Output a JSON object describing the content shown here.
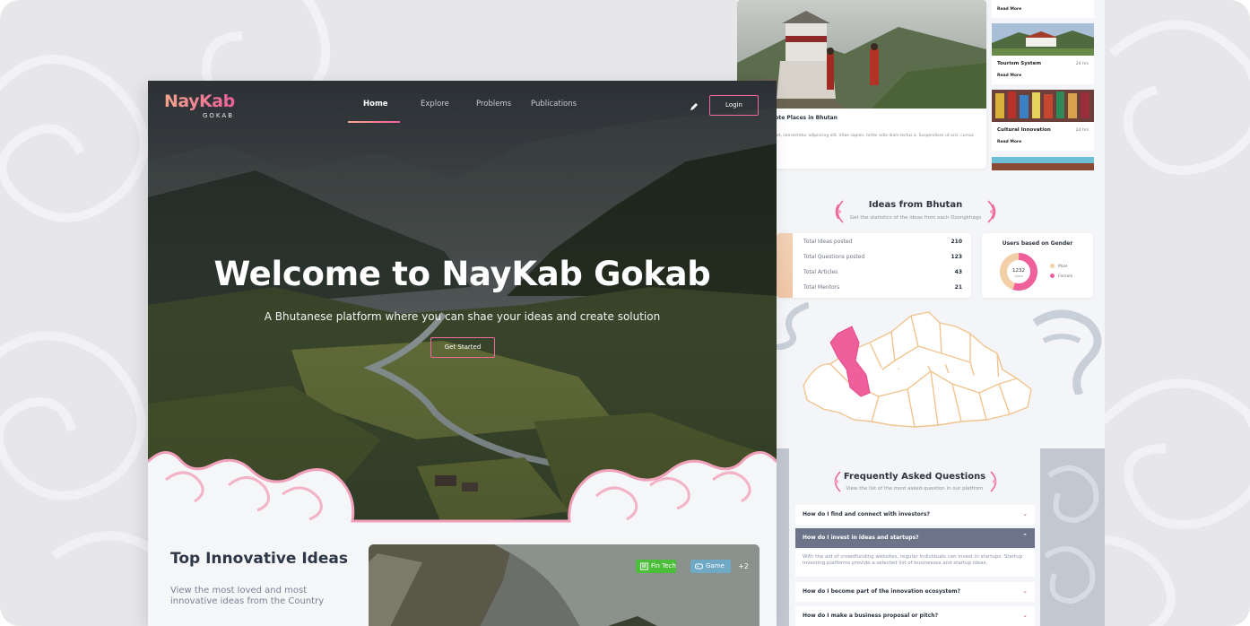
{
  "brand": {
    "name": "NayKab",
    "sub": "GOKAB"
  },
  "nav": {
    "items": [
      "Home",
      "Explore",
      "Problems",
      "Publications"
    ],
    "login": "Login"
  },
  "hero": {
    "title": "Welcome to NayKab Gokab",
    "subtitle": "A Bhutanese platform where you can shae your ideas and create solution",
    "cta": "Get Started"
  },
  "top_ideas": {
    "title": "Top Innovative Ideas",
    "subtitle": "View the most loved and most innovative ideas from the Country",
    "tags": [
      "Fin Tech",
      "Game"
    ],
    "more": "+2"
  },
  "feature": {
    "title": "mote Places in Bhutan",
    "text": "sit amet, consectetur adipiscing elit. Vitae sapien, tortor odio diam lectus a. Suspendisse ut orci, cursus cursus"
  },
  "side_list": [
    {
      "title": "",
      "date": "",
      "more": "Read More"
    },
    {
      "title": "Tourism System",
      "date": "24 hrs",
      "more": "Read More"
    },
    {
      "title": "Cultural Innovation",
      "date": "24 hrs",
      "more": "Read More"
    }
  ],
  "ideas": {
    "title": "Ideas from Bhutan",
    "subtitle": "Get the statistics of the ideas from each Dzongkhags",
    "stats": [
      {
        "label": "Total Ideas posted",
        "value": "210"
      },
      {
        "label": "Total Questions posted",
        "value": "123"
      },
      {
        "label": "Total Articles",
        "value": "43"
      },
      {
        "label": "Total Mentors",
        "value": "21"
      }
    ],
    "gender": {
      "title": "Users based on Gender",
      "total": "1232",
      "total_label": "Users",
      "male_label": "Male",
      "female_label": "Female",
      "male_fraction": 0.45,
      "female_fraction": 0.55,
      "male_color": "#f2cfa6",
      "female_color": "#ee5f9c"
    }
  },
  "faq": {
    "title": "Frequently Asked Questions",
    "subtitle": "View the list of the most asked question in our platfrom",
    "items": [
      {
        "q": "How do I find and connect with investors?"
      },
      {
        "q": "How do I invest in ideas and startups?"
      },
      {
        "q": "How do I become part of the innovation ecosystem?"
      },
      {
        "q": "How do I make a business proposal or pitch?"
      }
    ],
    "answer": "With the aid of crowdfunding websites, regular individuals can invest in startups. Startup investing platforms provide a selected list of businesses and startup ideas."
  },
  "colors": {
    "accent": "#ee5f9c",
    "accent_light": "#f6a98a",
    "ink": "#2d3748",
    "bg": "#e7e7ea"
  }
}
